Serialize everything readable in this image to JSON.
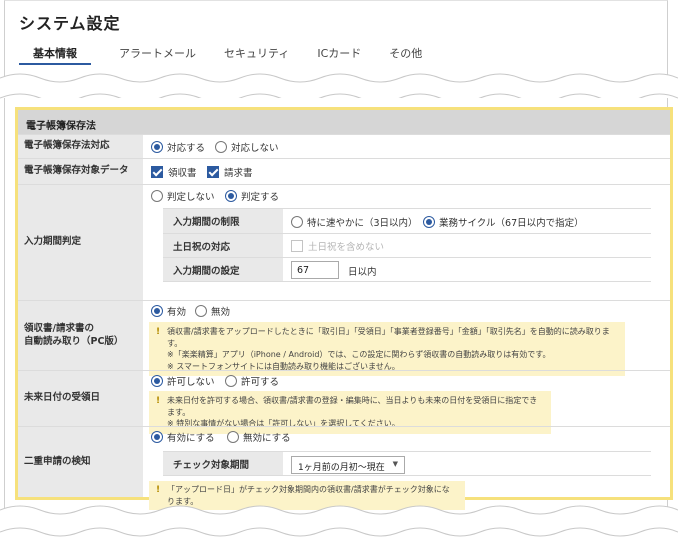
{
  "page": {
    "title": "システム設定"
  },
  "tabs": [
    "基本情報",
    "アラートメール",
    "セキュリティ",
    "ICカード",
    "その他"
  ],
  "section": {
    "title": "電子帳簿保存法"
  },
  "rows": {
    "support": {
      "label": "電子帳簿保存法対応",
      "options": [
        "対応する",
        "対応しない"
      ],
      "selected": 0
    },
    "target": {
      "label": "電子帳簿保存対象データ",
      "options": [
        "領収書",
        "請求書"
      ],
      "checked": [
        true,
        true
      ]
    },
    "period": {
      "label": "入力期間判定",
      "options": [
        "判定しない",
        "判定する"
      ],
      "selected": 1,
      "limit": {
        "label": "入力期間の制限",
        "options": [
          "特に速やかに（3日以内）",
          "業務サイクル（67日以内で指定）"
        ],
        "selected": 1
      },
      "holidays": {
        "label": "土日祝の対応",
        "checkbox_label": "土日祝を含めない",
        "disabled": true
      },
      "setting": {
        "label": "入力期間の設定",
        "value": "67",
        "unit": "日以内"
      }
    },
    "ocr": {
      "label_line1": "領収書/請求書の",
      "label_line2": "自動読み取り（PC版）",
      "options": [
        "有効",
        "無効"
      ],
      "selected": 0,
      "note_line1": "領収書/請求書をアップロードしたときに「取引日」「受領日」「事業者登録番号」「金額」「取引先名」を自動的に読み取ります。",
      "note_line2": "※「楽楽精算」アプリ（iPhone / Android）では、この設定に関わらず領収書の自動読み取りは有効です。",
      "note_line3": "※ スマートフォンサイトには自動読み取り機能はございません。"
    },
    "future": {
      "label": "未来日付の受領日",
      "options": [
        "許可しない",
        "許可する"
      ],
      "selected": 0,
      "note_line1": "未来日付を許可する場合、領収書/請求書の登録・編集時に、当日よりも未来の日付を受領日に指定できます。",
      "note_line2": "※ 特別な事情がない場合は「許可しない」を選択してください。"
    },
    "duplicate": {
      "label": "二重申請の検知",
      "options": [
        "有効にする",
        "無効にする"
      ],
      "selected": 0,
      "period_label": "チェック対象期間",
      "period_value": "1ヶ月前の月初～現在",
      "note": "「アップロード日」がチェック対象期間内の領収書/請求書がチェック対象になります。"
    }
  },
  "icons": {
    "caret": "chevron-down-icon",
    "note": "exclamation-icon"
  },
  "colors": {
    "accent": "#2c5aa0",
    "highlight_border": "#f6e17c",
    "note_bg": "#fcf3c9"
  }
}
